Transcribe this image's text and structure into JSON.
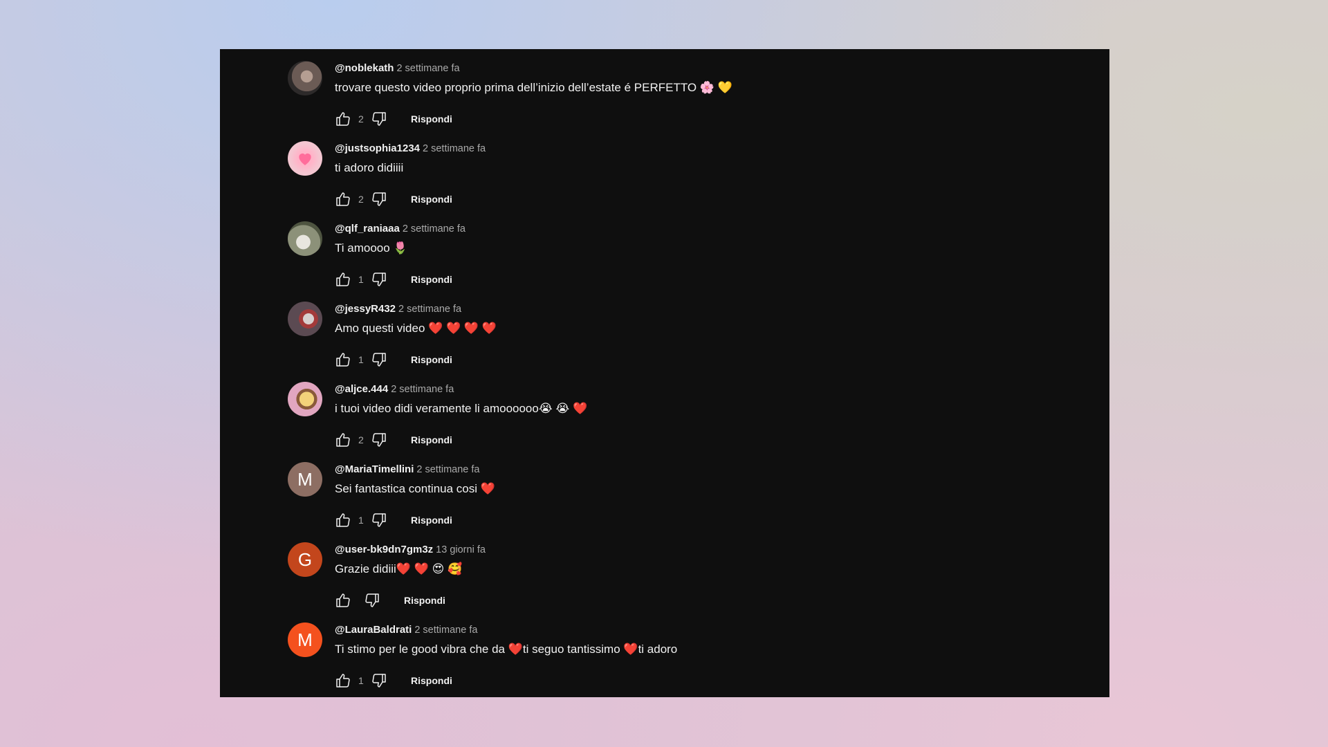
{
  "comments": [
    {
      "author": "@noblekath",
      "time": "2 settimane fa",
      "text": "trovare questo video proprio prima dell’inizio dell’estate é PERFETTO 🌸 💛",
      "likes": "2",
      "avatar": {
        "type": "photo",
        "colors": [
          "#6b5b55",
          "#2d2a2a",
          "#b59e92"
        ]
      }
    },
    {
      "author": "@justsophia1234",
      "time": "2 settimane fa",
      "text": "ti adoro didiiii",
      "likes": "2",
      "avatar": {
        "type": "heart",
        "colors": [
          "#f4c6d1",
          "#ff6d9b"
        ]
      }
    },
    {
      "author": "@qlf_raniaaa",
      "time": "2 settimane fa",
      "text": "Ti amoooo 🌷",
      "likes": "1",
      "avatar": {
        "type": "photo",
        "colors": [
          "#8c9179",
          "#e8e6df",
          "#4e5440"
        ]
      }
    },
    {
      "author": "@jessyR432",
      "time": "2 settimane fa",
      "text": "Amo questi video ❤️ ❤️ ❤️ ❤️",
      "likes": "1",
      "avatar": {
        "type": "photo",
        "colors": [
          "#5b4a52",
          "#d8d0cf",
          "#a33a3a"
        ]
      }
    },
    {
      "author": "@aljce.444",
      "time": "2 settimane fa",
      "text": "i tuoi video didi veramente li amoooooo😭 😭 ❤️",
      "likes": "2",
      "avatar": {
        "type": "photo",
        "colors": [
          "#e1a6c0",
          "#f3d27a",
          "#8a5a3a"
        ]
      }
    },
    {
      "author": "@MariaTimellini",
      "time": "2 settimane fa",
      "text": "Sei fantastica continua cosi ❤️",
      "likes": "1",
      "avatar": {
        "type": "letter",
        "letter": "M",
        "colors": [
          "#8d6e63"
        ]
      }
    },
    {
      "author": "@user-bk9dn7gm3z",
      "time": "13 giorni fa",
      "text": "Grazie didiii❤️ ❤️ 😍 🥰",
      "likes": "",
      "avatar": {
        "type": "letter",
        "letter": "G",
        "colors": [
          "#c3461c"
        ]
      }
    },
    {
      "author": "@LauraBaldrati",
      "time": "2 settimane fa",
      "text": "Ti stimo per le good vibra che da ❤️ti seguo tantissimo ❤️ti adoro",
      "likes": "1",
      "avatar": {
        "type": "letter",
        "letter": "M",
        "colors": [
          "#f4511e"
        ]
      }
    }
  ],
  "labels": {
    "reply": "Rispondi"
  },
  "icons": {
    "like": "thumb-up-icon",
    "dislike": "thumb-down-icon"
  },
  "theme": {
    "panel_bg": "#0f0f0f",
    "text": "#f1f1f1",
    "muted": "#aaaaaa"
  }
}
